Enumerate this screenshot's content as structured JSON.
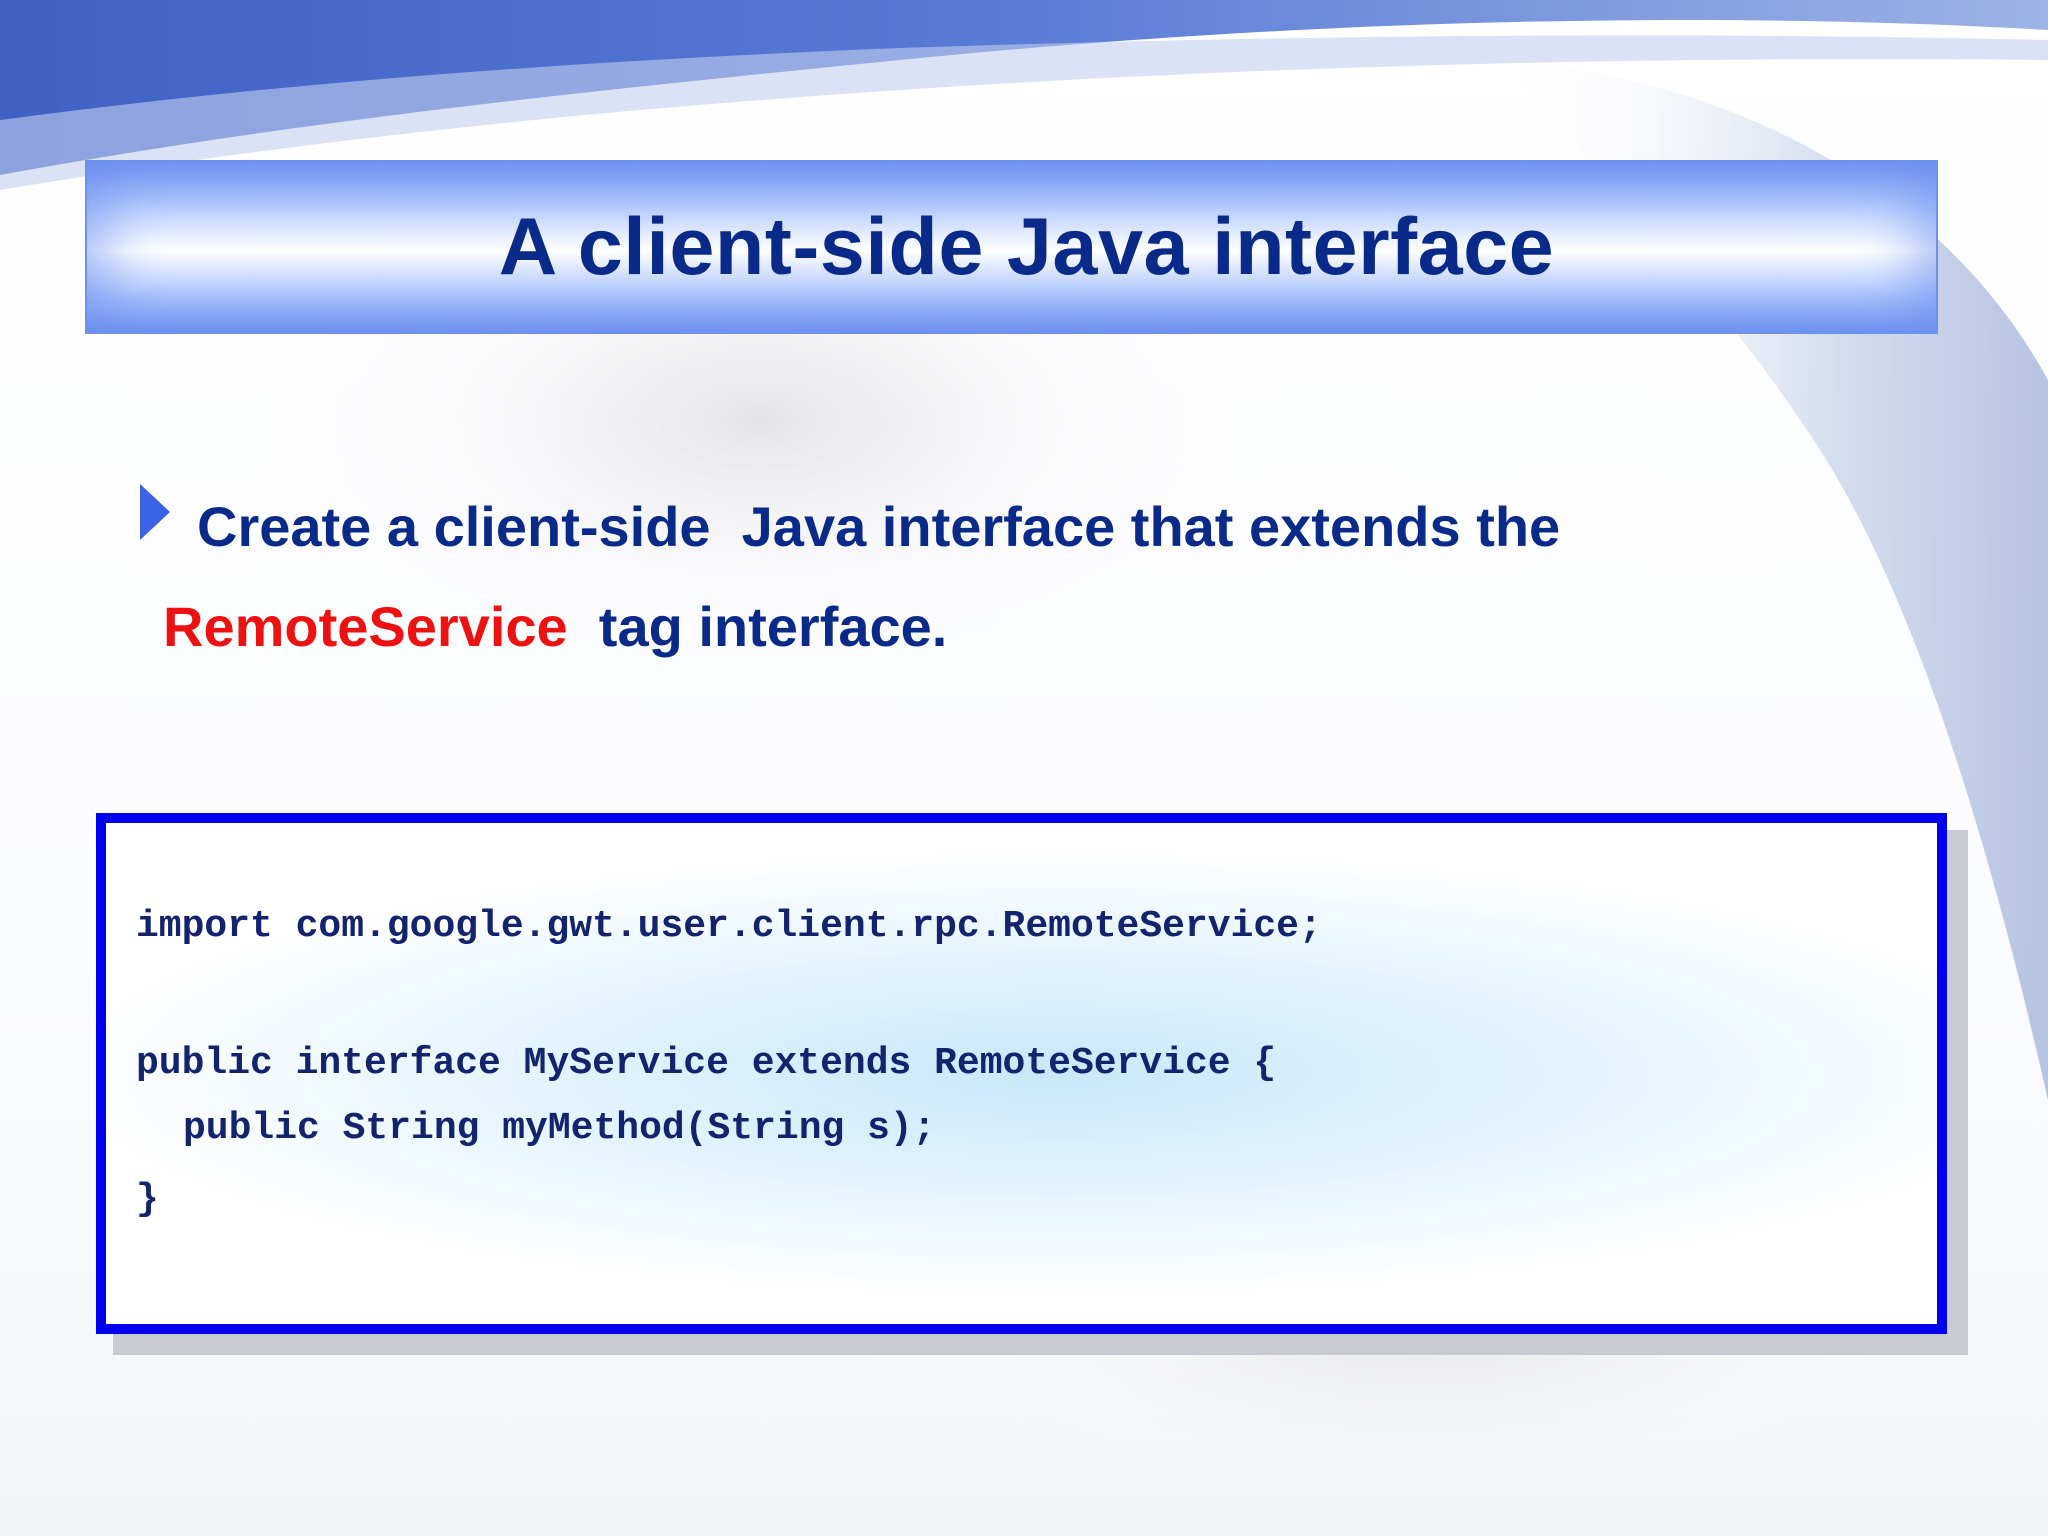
{
  "slide": {
    "title": "A client-side Java interface",
    "bullet": {
      "text_before": "Create a client-side  Java interface that extends the",
      "keyword": "RemoteService",
      "text_after": "  tag interface."
    },
    "code": {
      "lines": [
        "import com.google.gwt.user.client.rpc.RemoteService;",
        "public interface MyService extends RemoteService {",
        "public String myMethod(String s);",
        "}"
      ]
    }
  },
  "colors": {
    "title_text": "#0a2a8a",
    "body_text": "#0a2a8a",
    "keyword": "#ee1111",
    "code_text": "#14236e",
    "code_border": "#0000ee",
    "banner_blue": "#7a9cf4"
  }
}
